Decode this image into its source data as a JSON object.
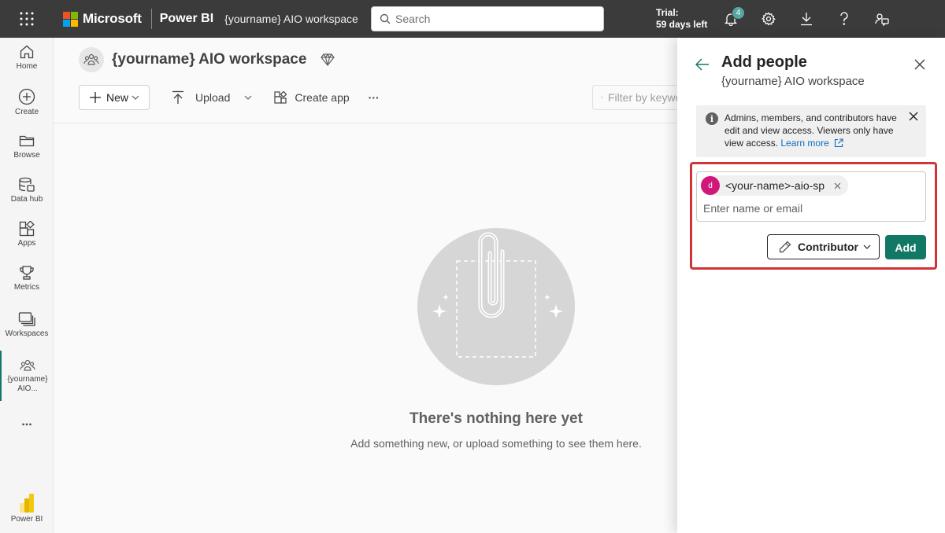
{
  "topbar": {
    "brand": "Microsoft",
    "product": "Power BI",
    "workspace": "{yourname} AIO workspace",
    "search_placeholder": "Search",
    "trial_line1": "Trial:",
    "trial_line2": "59 days left",
    "notification_count": "4",
    "icons": [
      "waffle-icon",
      "bell-icon",
      "gear-icon",
      "download-icon",
      "help-icon",
      "share-feedback-icon"
    ]
  },
  "nav": {
    "items": [
      {
        "label": "Home",
        "icon": "home-icon"
      },
      {
        "label": "Create",
        "icon": "plus-circle-icon"
      },
      {
        "label": "Browse",
        "icon": "folder-icon"
      },
      {
        "label": "Data hub",
        "icon": "database-icon"
      },
      {
        "label": "Apps",
        "icon": "apps-icon"
      },
      {
        "label": "Metrics",
        "icon": "trophy-icon"
      },
      {
        "label": "Workspaces",
        "icon": "workspaces-icon"
      },
      {
        "label": "{yourname}",
        "label2": "AIO...",
        "icon": "workspace-people-icon"
      },
      {
        "label": "...",
        "icon": "more-icon"
      }
    ],
    "footer_label": "Power BI"
  },
  "main": {
    "workspace_title": "{yourname} AIO workspace",
    "toolbar": {
      "new_label": "New",
      "upload_label": "Upload",
      "create_app_label": "Create app",
      "more_label": "···",
      "filter_placeholder": "Filter by keyword"
    },
    "empty_title": "There's nothing here yet",
    "empty_subtitle": "Add something new, or upload something to see them here."
  },
  "panel": {
    "title": "Add people",
    "subtitle": "{yourname} AIO workspace",
    "info_text": "Admins, members, and contributors have edit and view access. Viewers only have view access.",
    "info_link": "Learn more",
    "chip_initial": "d",
    "chip_name": "<your-name>-aio-sp",
    "input_placeholder": "Enter name or email",
    "role_label": "Contributor",
    "add_label": "Add"
  },
  "colors": {
    "topbar": "#3b3b3b",
    "accent": "#117865",
    "highlight": "#d13438",
    "chip_avatar": "#d1187a",
    "link": "#0f6cbd"
  }
}
